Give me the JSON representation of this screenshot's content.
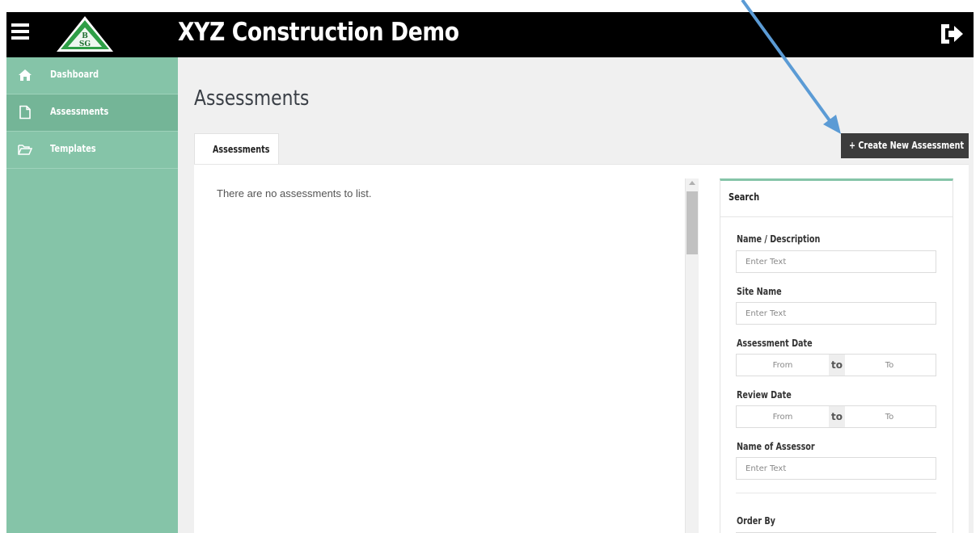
{
  "app": {
    "title": "XYZ Construction Demo",
    "logo_letters": "BSG",
    "menu_icon": "hamburger-icon",
    "logout_icon": "sign-out-icon"
  },
  "sidebar": {
    "items": [
      {
        "label": "Dashboard",
        "icon": "home-icon"
      },
      {
        "label": "Assessments",
        "icon": "file-icon",
        "active": true
      },
      {
        "label": "Templates",
        "icon": "folder-open-icon"
      }
    ]
  },
  "main": {
    "page_title": "Assessments",
    "tab_label": "Assessments",
    "create_button": "+ Create New Assessment",
    "empty_message": "There are no assessments to list."
  },
  "search": {
    "title": "Search",
    "name_label": "Name / Description",
    "name_placeholder": "Enter Text",
    "site_label": "Site Name",
    "site_placeholder": "Enter Text",
    "assessment_date_label": "Assessment Date",
    "review_date_label": "Review Date",
    "from_placeholder": "From",
    "to_separator": "to",
    "to_placeholder": "To",
    "assessor_label": "Name of Assessor",
    "assessor_placeholder": "Enter Text",
    "order_by_label": "Order By"
  },
  "colors": {
    "sidebar": "#85c4a8",
    "sidebar_active": "#74b597",
    "topbar": "#000000",
    "button": "#3c3c3c",
    "annotation_arrow": "#5b9bd5",
    "logo_green": "#2e9e46"
  }
}
